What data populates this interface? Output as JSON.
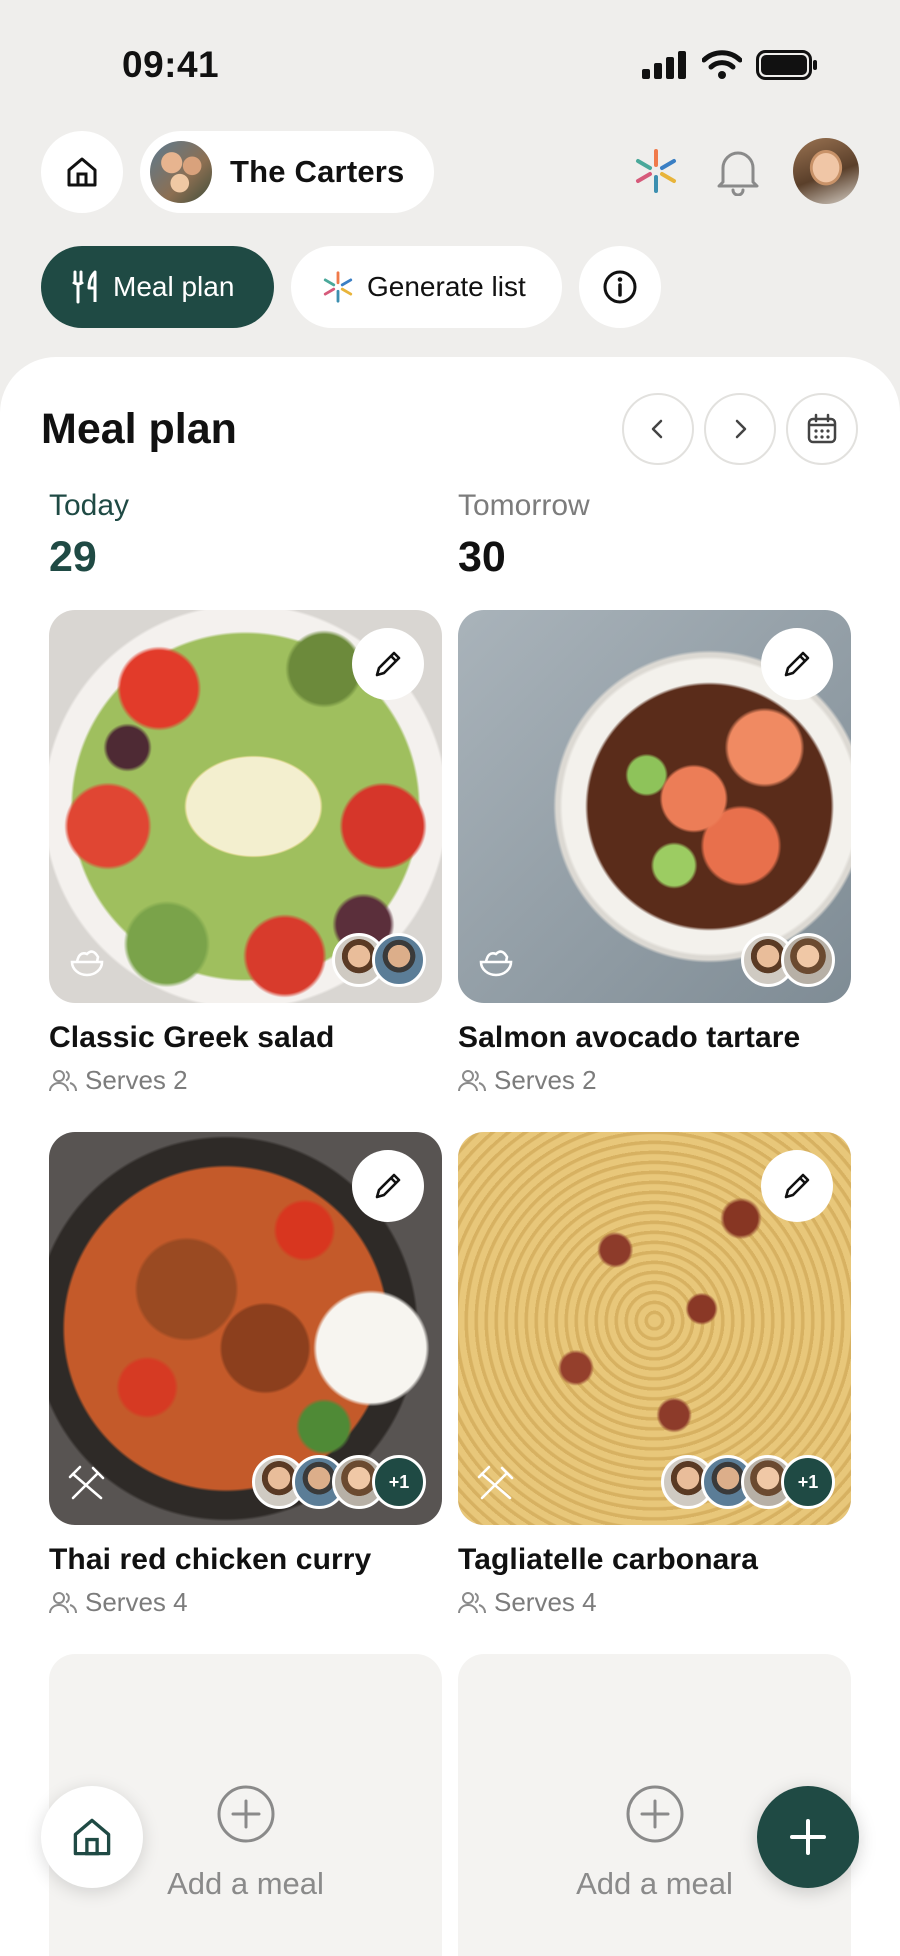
{
  "status_bar": {
    "time": "09:41"
  },
  "header": {
    "family_name": "The Carters"
  },
  "chips": {
    "meal_plan": "Meal plan",
    "generate_list": "Generate list"
  },
  "sheet": {
    "title": "Meal plan",
    "days": [
      {
        "label": "Today",
        "number": "29"
      },
      {
        "label": "Tomorrow",
        "number": "30"
      }
    ],
    "meals": [
      {
        "title": "Classic Greek salad",
        "serves": "Serves 2",
        "type_icon": "salad-bowl-icon",
        "extra": ""
      },
      {
        "title": "Salmon avocado tartare",
        "serves": "Serves 2",
        "type_icon": "salad-bowl-icon",
        "extra": ""
      },
      {
        "title": "Thai red chicken curry",
        "serves": "Serves 4",
        "type_icon": "cutlery-icon",
        "extra": "+1"
      },
      {
        "title": "Tagliatelle carbonara",
        "serves": "Serves 4",
        "type_icon": "cutlery-icon",
        "extra": "+1"
      }
    ],
    "add_meal": [
      {
        "label": "Add a meal"
      },
      {
        "label": "Add a meal"
      }
    ]
  },
  "colors": {
    "accent": "#1f4a44",
    "background": "#efeeec",
    "muted_text": "#7c7c7c"
  }
}
